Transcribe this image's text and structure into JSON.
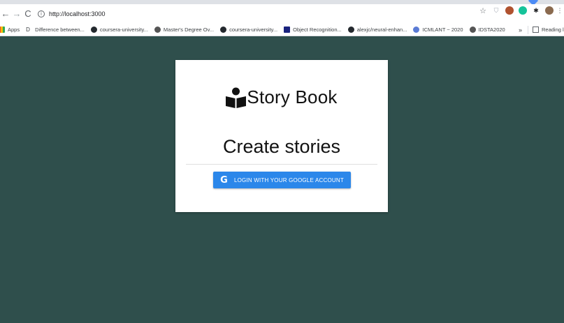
{
  "browser": {
    "url": "http://localhost:3000",
    "bookmarks": [
      {
        "label": "Apps",
        "icon": "apps-grid-icon",
        "color": "#ea4335"
      },
      {
        "label": "Difference between...",
        "icon": "d-letter-icon",
        "color": "#444444"
      },
      {
        "label": "coursera-university...",
        "icon": "github-icon",
        "color": "#24292e"
      },
      {
        "label": "Master's Degree Ov...",
        "icon": "globe-icon",
        "color": "#555555"
      },
      {
        "label": "coursera-university...",
        "icon": "github-icon",
        "color": "#24292e"
      },
      {
        "label": "Object Recognition...",
        "icon": "dataset-icon",
        "color": "#1a237e"
      },
      {
        "label": "alexjc/neural-enhan...",
        "icon": "github-icon",
        "color": "#24292e"
      },
      {
        "label": "ICMLANT ~ 2020",
        "icon": "icml-icon",
        "color": "#5b7bd5"
      },
      {
        "label": "IDSTA2020",
        "icon": "globe-icon",
        "color": "#555555"
      }
    ],
    "overflow": "»",
    "reading_list": "Reading list"
  },
  "page": {
    "background": "#2f4f4c",
    "brand_title": "Story Book",
    "headline": "Create stories",
    "login_button": "LOGIN WITH YOUR GOOGLE ACCOUNT",
    "login_icon": "google-g-icon",
    "accent": "#2b87ea"
  }
}
